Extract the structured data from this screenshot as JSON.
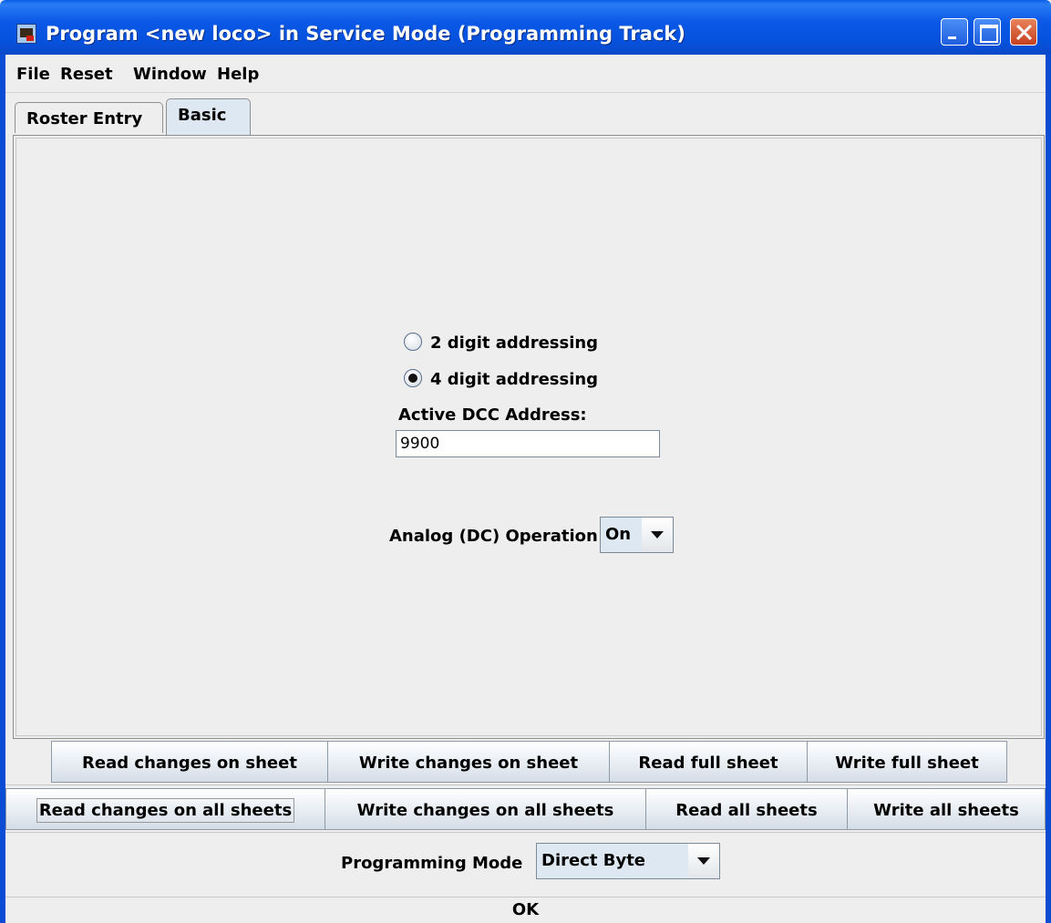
{
  "window": {
    "title": "Program <new loco> in Service Mode (Programming Track)",
    "icon": "locomotive-icon",
    "colors": {
      "titlebar": "#0a5fe9",
      "close_button": "#c5401e",
      "background": "#eeeeee",
      "selected_tab": "#dde8f3"
    }
  },
  "menu": {
    "items": [
      "File",
      "Reset",
      "Window",
      "Help"
    ]
  },
  "tabs": [
    {
      "label": "Roster Entry",
      "selected": false
    },
    {
      "label": "Basic",
      "selected": true
    }
  ],
  "basic": {
    "addressing": [
      {
        "label": "2 digit addressing",
        "checked": false
      },
      {
        "label": "4 digit addressing",
        "checked": true
      }
    ],
    "dcc_address_label": "Active DCC Address:",
    "dcc_address_value": "9900",
    "analog_label": "Analog (DC) Operation",
    "analog_value": "On"
  },
  "sheet_buttons": [
    "Read changes on sheet",
    "Write changes on sheet",
    "Read full sheet",
    "Write full sheet"
  ],
  "all_buttons": [
    "Read changes on all sheets",
    "Write changes on all sheets",
    "Read all sheets",
    "Write all sheets"
  ],
  "programming_mode": {
    "label": "Programming Mode",
    "value": "Direct Byte"
  },
  "status": "OK"
}
